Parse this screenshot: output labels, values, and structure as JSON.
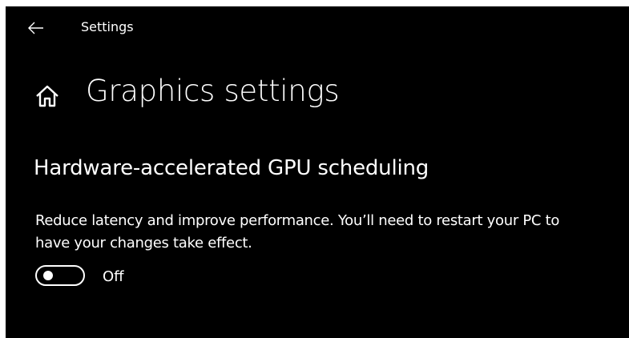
{
  "header": {
    "back_icon": "arrow-left-icon",
    "app_title": "Settings"
  },
  "page": {
    "home_icon": "home-icon",
    "title": "Graphics settings"
  },
  "gpu_scheduling": {
    "section_title": "Hardware-accelerated GPU scheduling",
    "description": "Reduce latency and improve performance. You’ll need to restart your PC to have your changes take effect.",
    "toggle_state_label": "Off",
    "toggle_on": false
  },
  "colors": {
    "background": "#000000",
    "text": "#ffffff"
  }
}
